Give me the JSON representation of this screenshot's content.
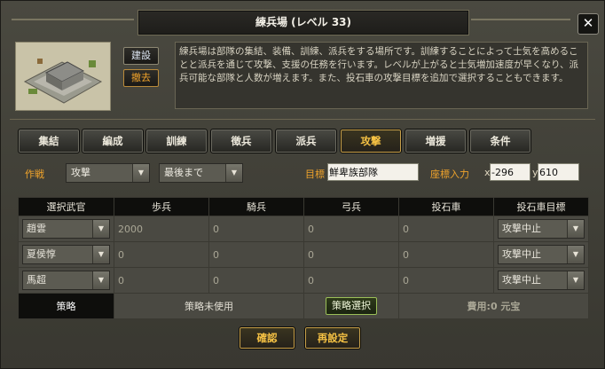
{
  "window": {
    "title": "練兵場 (レベル 33)",
    "close_glyph": "✕",
    "build_button": "建設",
    "remove_button": "撤去",
    "description": "練兵場は部隊の集結、装備、訓練、派兵をする場所です。訓練することによって士気を高めることと派兵を通じて攻撃、支援の任務を行います。レベルが上がると士気増加速度が早くなり、派兵可能な部隊と人数が増えます。また、投石車の攻撃目標を追加で選択することもできます。"
  },
  "tabs": [
    {
      "label": "集結",
      "active": false
    },
    {
      "label": "編成",
      "active": false
    },
    {
      "label": "訓練",
      "active": false
    },
    {
      "label": "徴兵",
      "active": false
    },
    {
      "label": "派兵",
      "active": false
    },
    {
      "label": "攻撃",
      "active": true
    },
    {
      "label": "増援",
      "active": false
    },
    {
      "label": "条件",
      "active": false
    }
  ],
  "filter": {
    "strategy_label": "作戦",
    "strategy_value": "攻撃",
    "duration_value": "最後まで",
    "target_label": "目標",
    "target_value": "鮮卑族部隊",
    "coord_label": "座標入力",
    "x_prefix": "x",
    "x_value": "-296",
    "y_prefix": "y",
    "y_value": "610"
  },
  "table": {
    "headers": [
      "選択武官",
      "歩兵",
      "騎兵",
      "弓兵",
      "投石車",
      "投石車目標"
    ],
    "rows": [
      {
        "officer": "趙雲",
        "infantry": "2000",
        "cavalry": "0",
        "archer": "0",
        "catapult": "0",
        "target": "攻撃中止"
      },
      {
        "officer": "夏侯惇",
        "infantry": "0",
        "cavalry": "0",
        "archer": "0",
        "catapult": "0",
        "target": "攻撃中止"
      },
      {
        "officer": "馬超",
        "infantry": "0",
        "cavalry": "0",
        "archer": "0",
        "catapult": "0",
        "target": "攻撃中止"
      }
    ],
    "strategy_label": "策略",
    "strategy_status": "策略未使用",
    "strategy_button": "策略選択",
    "cost": "費用:0 元宝"
  },
  "footer": {
    "confirm_button": "確認",
    "reset_button": "再設定"
  },
  "icons": {
    "dropdown": "chevron-down-icon",
    "close": "close-icon",
    "building": "barracks-building-icon"
  },
  "colors": {
    "accent": "#f0a32b",
    "active_tab_text": "#f6c244",
    "strategy_button_border": "#9bbf58"
  }
}
